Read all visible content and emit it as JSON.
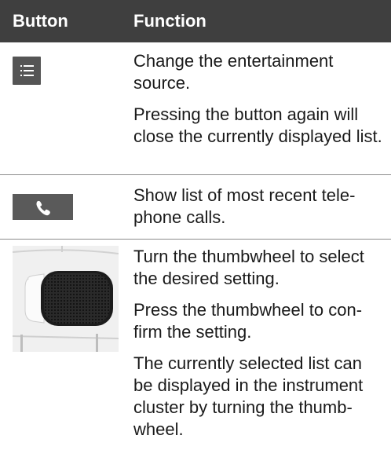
{
  "header": {
    "col1": "Button",
    "col2": "Function"
  },
  "rows": [
    {
      "icon": "list-menu-icon",
      "paragraphs": [
        "Change the entertainment source.",
        "Pressing the button again will close the currently displayed list."
      ]
    },
    {
      "icon": "phone-handset-icon",
      "paragraphs": [
        "Show list of most recent tele­phone calls."
      ]
    },
    {
      "icon": "thumbwheel-image",
      "paragraphs": [
        "Turn the thumbwheel to select the desired setting.",
        "Press the thumbwheel to con­firm the setting.",
        "The currently selected list can be displayed in the instrument cluster by turning the thumb­wheel."
      ]
    }
  ]
}
